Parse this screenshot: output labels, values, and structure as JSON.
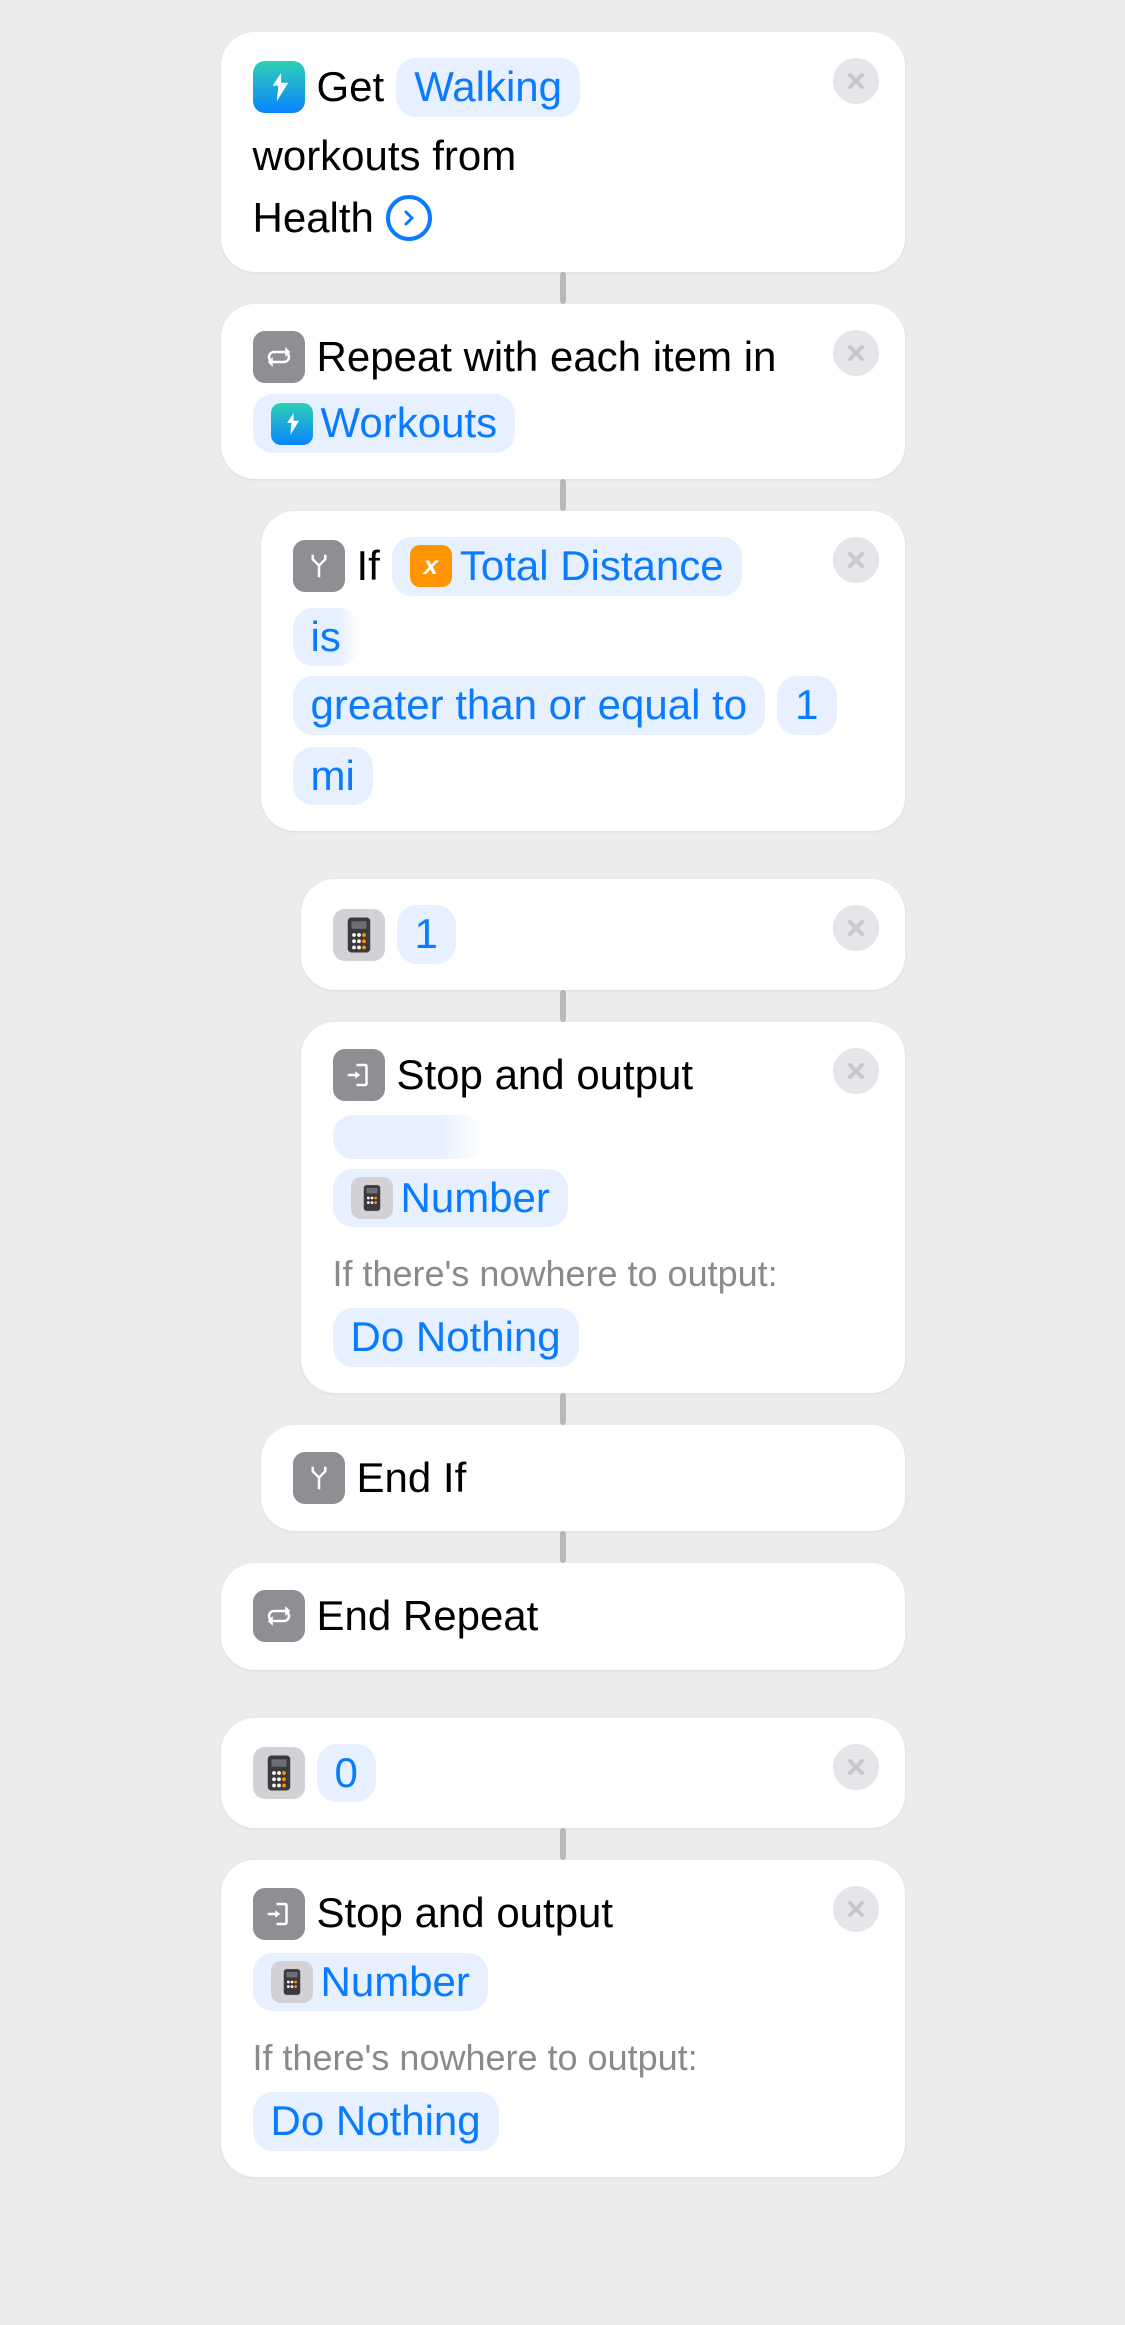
{
  "a1": {
    "pre": "Get",
    "param": "Walking",
    "post": "workouts from",
    "tail": "Health"
  },
  "a2": {
    "pre": "Repeat with each item in",
    "param": "Workouts"
  },
  "a3": {
    "pre": "If",
    "var": "Total Distance",
    "cond1": "is",
    "cond2": "greater than or equal to",
    "num": "1",
    "unit": "mi"
  },
  "a4": {
    "value": "1"
  },
  "a5": {
    "pre": "Stop and output",
    "param": "Number",
    "sub": "If there's nowhere to output:",
    "subparam": "Do Nothing"
  },
  "a6": {
    "label": "End If"
  },
  "a7": {
    "label": "End Repeat"
  },
  "a8": {
    "value": "0"
  },
  "a9": {
    "pre": "Stop and output",
    "param": "Number",
    "sub": "If there's nowhere to output:",
    "subparam": "Do Nothing"
  }
}
